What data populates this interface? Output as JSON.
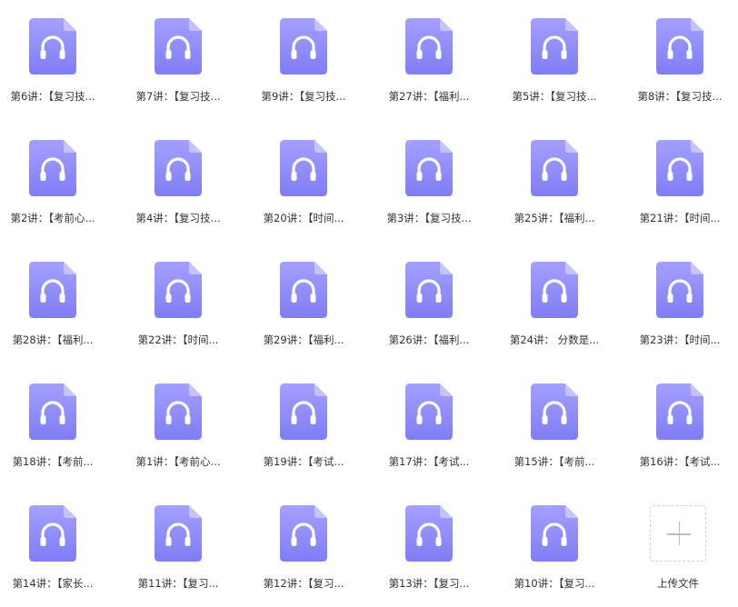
{
  "colors": {
    "file_icon_top": "#a4a0ff",
    "file_icon_bottom": "#7f7df5",
    "file_fold": "#c9c7ff",
    "headphone": "#ffffff",
    "label_text": "#333333"
  },
  "files": [
    {
      "label": "第6讲：【复习技...",
      "icon": "audio-file-icon"
    },
    {
      "label": "第7讲：【复习技...",
      "icon": "audio-file-icon"
    },
    {
      "label": "第9讲：【复习技...",
      "icon": "audio-file-icon"
    },
    {
      "label": "第27讲：【福利...",
      "icon": "audio-file-icon"
    },
    {
      "label": "第5讲：【复习技...",
      "icon": "audio-file-icon"
    },
    {
      "label": "第8讲：【复习技...",
      "icon": "audio-file-icon"
    },
    {
      "label": "第2讲：【考前心...",
      "icon": "audio-file-icon"
    },
    {
      "label": "第4讲：【复习技...",
      "icon": "audio-file-icon"
    },
    {
      "label": "第20讲：【时间...",
      "icon": "audio-file-icon"
    },
    {
      "label": "第3讲：【复习技...",
      "icon": "audio-file-icon"
    },
    {
      "label": "第25讲：【福利...",
      "icon": "audio-file-icon"
    },
    {
      "label": "第21讲：【时间...",
      "icon": "audio-file-icon"
    },
    {
      "label": "第28讲：【福利...",
      "icon": "audio-file-icon"
    },
    {
      "label": "第22讲：【时间...",
      "icon": "audio-file-icon"
    },
    {
      "label": "第29讲：【福利...",
      "icon": "audio-file-icon"
    },
    {
      "label": "第26讲：【福利...",
      "icon": "audio-file-icon"
    },
    {
      "label": "第24讲： 分数是...",
      "icon": "audio-file-icon"
    },
    {
      "label": "第23讲：【时间...",
      "icon": "audio-file-icon"
    },
    {
      "label": "第18讲：【考前...",
      "icon": "audio-file-icon"
    },
    {
      "label": "第1讲：【考前心...",
      "icon": "audio-file-icon"
    },
    {
      "label": "第19讲：【考试...",
      "icon": "audio-file-icon"
    },
    {
      "label": "第17讲：【考试...",
      "icon": "audio-file-icon"
    },
    {
      "label": "第15讲：【考前...",
      "icon": "audio-file-icon"
    },
    {
      "label": "第16讲：【考试...",
      "icon": "audio-file-icon"
    },
    {
      "label": "第14讲：【家长...",
      "icon": "audio-file-icon"
    },
    {
      "label": "第11讲：【复习...",
      "icon": "audio-file-icon"
    },
    {
      "label": "第12讲：【复习...",
      "icon": "audio-file-icon"
    },
    {
      "label": "第13讲：【复习...",
      "icon": "audio-file-icon"
    },
    {
      "label": "第10讲：【复习...",
      "icon": "audio-file-icon"
    }
  ],
  "upload": {
    "label": "上传文件",
    "icon": "plus-icon"
  }
}
